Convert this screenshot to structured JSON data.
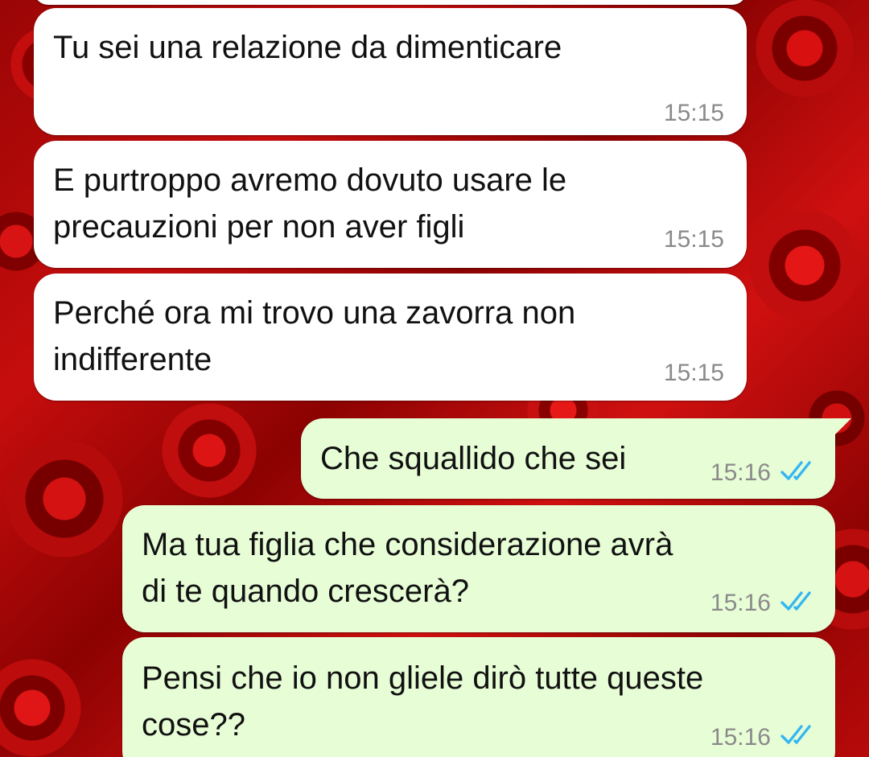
{
  "messages": [
    {
      "direction": "incoming",
      "text": "Tu sei una relazione da dimenticare",
      "time": "15:15"
    },
    {
      "direction": "incoming",
      "text": "E purtroppo avremo dovuto usare le\nprecauzioni per non aver figli",
      "time": "15:15"
    },
    {
      "direction": "incoming",
      "text": "Perché ora mi trovo una zavorra non\nindifferente",
      "time": "15:15"
    },
    {
      "direction": "outgoing",
      "text": "Che squallido che sei",
      "time": "15:16",
      "status": "read"
    },
    {
      "direction": "outgoing",
      "text": "Ma tua figlia che considerazione avrà\ndi te quando crescerà?",
      "time": "15:16",
      "status": "read"
    },
    {
      "direction": "outgoing",
      "text": "Pensi che io non gliele dirò tutte queste\ncose??",
      "time": "15:16",
      "status": "read"
    }
  ],
  "colors": {
    "incoming_bubble": "#ffffff",
    "outgoing_bubble": "#e7fdd6",
    "read_ticks": "#34b7f1",
    "timestamp": "#8a8a8a",
    "wallpaper": "#c60d0d"
  },
  "icons": {
    "read_receipt": "double-check-icon",
    "wallpaper": "red-roses-wallpaper"
  }
}
